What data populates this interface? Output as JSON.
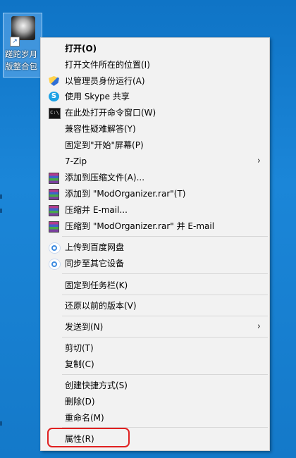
{
  "desktop_icon": {
    "label_line1": "蹉跎岁月",
    "label_line2": "版整合包"
  },
  "menu": {
    "open": "打开(O)",
    "open_location": "打开文件所在的位置(I)",
    "run_as_admin": "以管理员身份运行(A)",
    "skype_share": "使用 Skype 共享",
    "open_cmd": "在此处打开命令窗口(W)",
    "troubleshoot": "兼容性疑难解答(Y)",
    "pin_start": "固定到\"开始\"屏幕(P)",
    "zip": "7-Zip",
    "add_archive": "添加到压缩文件(A)...",
    "add_rar": "添加到 \"ModOrganizer.rar\"(T)",
    "compress_email": "压缩并 E-mail...",
    "compress_rar_email": "压缩到 \"ModOrganizer.rar\" 并 E-mail",
    "upload_baidu": "上传到百度网盘",
    "sync_device": "同步至其它设备",
    "pin_taskbar": "固定到任务栏(K)",
    "restore_versions": "还原以前的版本(V)",
    "send_to": "发送到(N)",
    "cut": "剪切(T)",
    "copy": "复制(C)",
    "create_shortcut": "创建快捷方式(S)",
    "delete": "删除(D)",
    "rename": "重命名(M)",
    "properties": "属性(R)"
  },
  "colors": {
    "highlight": "#e02020",
    "desktop": "#1479c9",
    "menu_bg": "#f2f2f2"
  },
  "icons": [
    "shield-uac-icon",
    "skype-icon",
    "cmd-icon",
    "winrar-icon",
    "baidu-cloud-icon",
    "submenu-arrow-icon"
  ]
}
